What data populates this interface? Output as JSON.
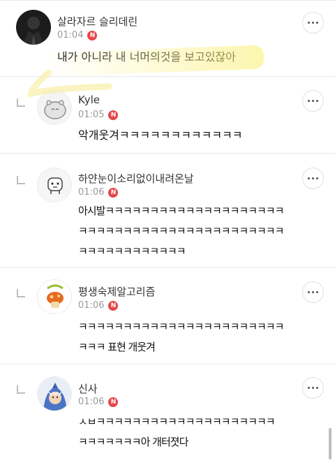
{
  "comments": [
    {
      "nick": "살라자르 슬리데린",
      "time": "01:04",
      "badge": "N",
      "body": "내가 아니라 내 너머의것을 보고있잖아",
      "avatar": "dark-suit-avatar"
    },
    {
      "nick": "Kyle",
      "time": "01:05",
      "badge": "N",
      "body": "악개웃겨ㅋㅋㅋㅋㅋㅋㅋㅋㅋㅋㅋㅋ",
      "avatar": "hippo-avatar"
    },
    {
      "nick": "하얀눈이소리없이내려온날",
      "time": "01:06",
      "badge": "N",
      "body": "아시발ㅋㅋㅋㅋㅋㅋㅋㅋㅋㅋㅋㅋㅋㅋㅋㅋㅋㅋㅋㅋ\nㅋㅋㅋㅋㅋㅋㅋㅋㅋㅋㅋㅋㅋㅋㅋㅋㅋㅋㅋㅋㅋㅋㅋ\nㅋㅋㅋㅋㅋㅋㅋㅋㅋㅋㅋㅋ",
      "avatar": "penguin-avatar"
    },
    {
      "nick": "평생숙제알고리즘",
      "time": "01:06",
      "badge": "N",
      "body": "ㅋㅋㅋㅋㅋㅋㅋㅋㅋㅋㅋㅋㅋㅋㅋㅋㅋㅋㅋㅋㅋㅋㅋ\nㅋㅋㅋ 표현 개웃겨",
      "avatar": "mushroom-avatar"
    },
    {
      "nick": "신사",
      "time": "01:06",
      "badge": "N",
      "body": "ㅅㅂㅋㅋㅋㅋㅋㅋㅋㅋㅋㅋㅋㅋㅋㅋㅋㅋㅋㅋㅋㅋ\nㅋㅋㅋㅋㅋㅋㅋ아 개터졋다",
      "avatar": "shark-costume-avatar"
    }
  ],
  "colors": {
    "badge": "#e5474a",
    "highlight": "#f6ef8a",
    "divider": "#e6e6e6"
  },
  "icons": {
    "more": "more-horizontal-icon",
    "reply": "reply-corner-icon"
  }
}
